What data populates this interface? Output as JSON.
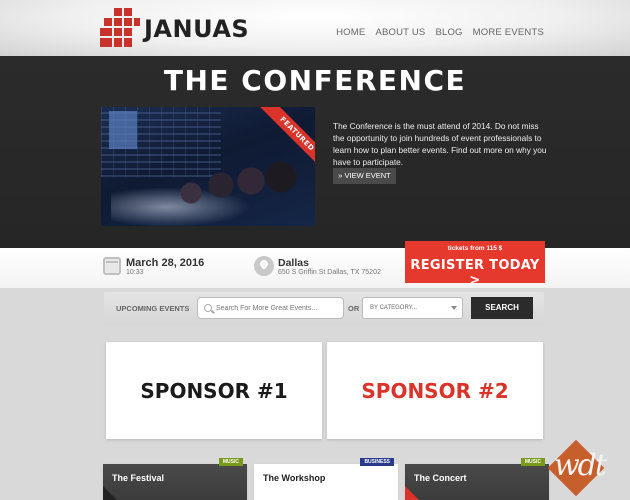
{
  "header": {
    "logo_text": "JANUAS",
    "nav": [
      "HOME",
      "ABOUT US",
      "BLOG",
      "MORE EVENTS"
    ]
  },
  "hero": {
    "title": "THE CONFERENCE",
    "featured_label": "FEATURED",
    "description": "The Conference is the must attend of 2014. Do not miss the opportunity to join hundreds of event professionals to learn how to plan better events. Find out more on why you have to participate.",
    "view_button": "» VIEW EVENT"
  },
  "info": {
    "date": "March 28, 2016",
    "time": "10:33",
    "location": "Dallas",
    "address": "650 S Griffin St Dallas, TX 75202",
    "register_small": "tickets from 115 $",
    "register_big": "REGISTER TODAY >"
  },
  "search": {
    "label": "UPCOMING EVENTS",
    "placeholder": "Search For More Great Events...",
    "or_label": "OR",
    "category_selected": "BY CATEGORY...",
    "button": "SEARCH"
  },
  "sponsors": [
    {
      "label": "SPONSOR #1",
      "color": "#1a1a1a"
    },
    {
      "label": "SPONSOR #2",
      "color": "#d9332a"
    }
  ],
  "events": [
    {
      "name": "The Festival",
      "tag": "MUSIC",
      "tag_color": "#7a9a1a"
    },
    {
      "name": "The Workshop",
      "tag": "BUSINESS",
      "tag_color": "#2a3a8a"
    },
    {
      "name": "The Concert",
      "tag": "MUSIC",
      "tag_color": "#7a9a1a"
    }
  ],
  "watermark": {
    "text": "wdt"
  },
  "colors": {
    "accent": "#e5392e",
    "dark": "#2b2b2b"
  }
}
